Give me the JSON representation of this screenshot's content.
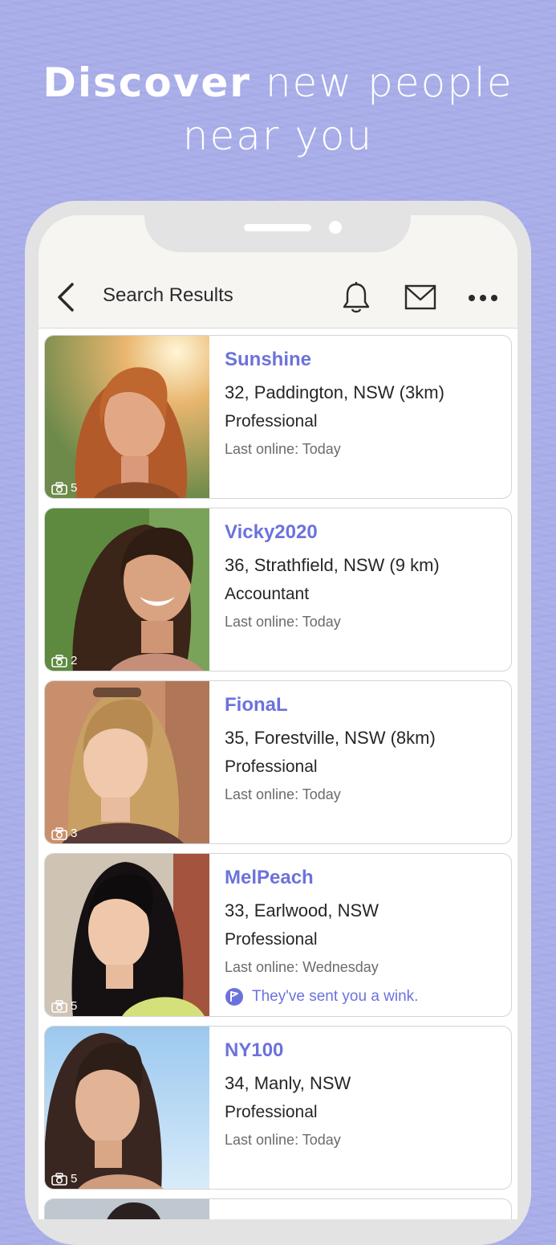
{
  "headline": {
    "strong": "Discover",
    "rest_line1": "new people",
    "line2": "near you"
  },
  "appbar": {
    "title": "Search Results",
    "icons": [
      "back-icon",
      "bell-icon",
      "mail-icon",
      "more-icon"
    ]
  },
  "colors": {
    "accent": "#6c72db",
    "background": "#a9aee9"
  },
  "profiles": [
    {
      "name": "Sunshine",
      "location": "32, Paddington, NSW (3km)",
      "occupation": "Professional",
      "last_online": "Last online: Today",
      "photo_count": "5",
      "wink": ""
    },
    {
      "name": "Vicky2020",
      "location": "36, Strathfield, NSW (9 km)",
      "occupation": "Accountant",
      "last_online": "Last online: Today",
      "photo_count": "2",
      "wink": ""
    },
    {
      "name": "FionaL",
      "location": "35, Forestville, NSW (8km)",
      "occupation": "Professional",
      "last_online": "Last online: Today",
      "photo_count": "3",
      "wink": ""
    },
    {
      "name": "MelPeach",
      "location": "33, Earlwood, NSW",
      "occupation": "Professional",
      "last_online": "Last online: Wednesday",
      "photo_count": "5",
      "wink": "They've sent you a wink."
    },
    {
      "name": "NY100",
      "location": "34, Manly, NSW",
      "occupation": "Professional",
      "last_online": "Last online: Today",
      "photo_count": "5",
      "wink": ""
    }
  ]
}
